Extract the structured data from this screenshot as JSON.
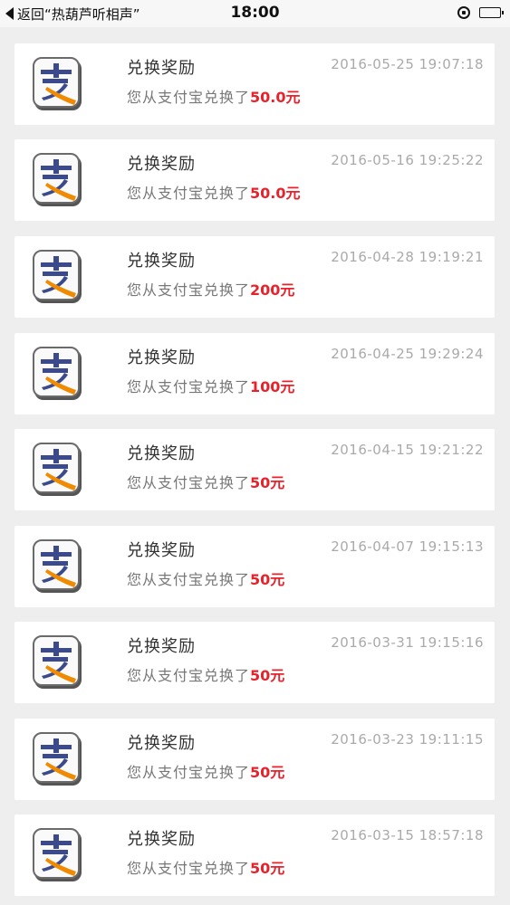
{
  "status_bar": {
    "back_label": "返回“热葫芦听相声”",
    "time": "18:00",
    "icons": [
      "rotation-lock-icon",
      "battery-icon"
    ]
  },
  "icon_colors": {
    "glyph": "#3a4a8c",
    "swoosh": "#f08a00",
    "border": "#6a6a6a"
  },
  "amount_color": "#e8212a",
  "records": [
    {
      "title": "兑换奖励",
      "time": "2016-05-25 19:07:18",
      "desc": "您从支付宝兑换了",
      "amount": "50.0元"
    },
    {
      "title": "兑换奖励",
      "time": "2016-05-16 19:25:22",
      "desc": "您从支付宝兑换了",
      "amount": "50.0元"
    },
    {
      "title": "兑换奖励",
      "time": "2016-04-28 19:19:21",
      "desc": "您从支付宝兑换了",
      "amount": "200元"
    },
    {
      "title": "兑换奖励",
      "time": "2016-04-25 19:29:24",
      "desc": "您从支付宝兑换了",
      "amount": "100元"
    },
    {
      "title": "兑换奖励",
      "time": "2016-04-15 19:21:22",
      "desc": "您从支付宝兑换了",
      "amount": "50元"
    },
    {
      "title": "兑换奖励",
      "time": "2016-04-07 19:15:13",
      "desc": "您从支付宝兑换了",
      "amount": "50元"
    },
    {
      "title": "兑换奖励",
      "time": "2016-03-31 19:15:16",
      "desc": "您从支付宝兑换了",
      "amount": "50元"
    },
    {
      "title": "兑换奖励",
      "time": "2016-03-23 19:11:15",
      "desc": "您从支付宝兑换了",
      "amount": "50元"
    },
    {
      "title": "兑换奖励",
      "time": "2016-03-15 18:57:18",
      "desc": "您从支付宝兑换了",
      "amount": "50元"
    }
  ]
}
